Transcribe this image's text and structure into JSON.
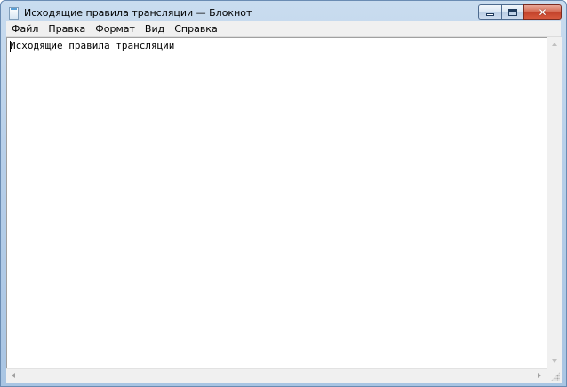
{
  "window": {
    "title": "Исходящие правила трансляции — Блокнот",
    "icon": "notepad-icon"
  },
  "caption_buttons": {
    "minimize": "minimize-icon",
    "maximize": "maximize-icon",
    "close_glyph": "✕"
  },
  "menu": {
    "items": [
      {
        "label": "Файл"
      },
      {
        "label": "Правка"
      },
      {
        "label": "Формат"
      },
      {
        "label": "Вид"
      },
      {
        "label": "Справка"
      }
    ]
  },
  "editor": {
    "content": "Исходящие правила трансляции"
  },
  "colors": {
    "frame": "#b7cfe9",
    "close_button": "#c1412a",
    "menubar": "#f0f0f0",
    "editor_background": "#ffffff"
  }
}
